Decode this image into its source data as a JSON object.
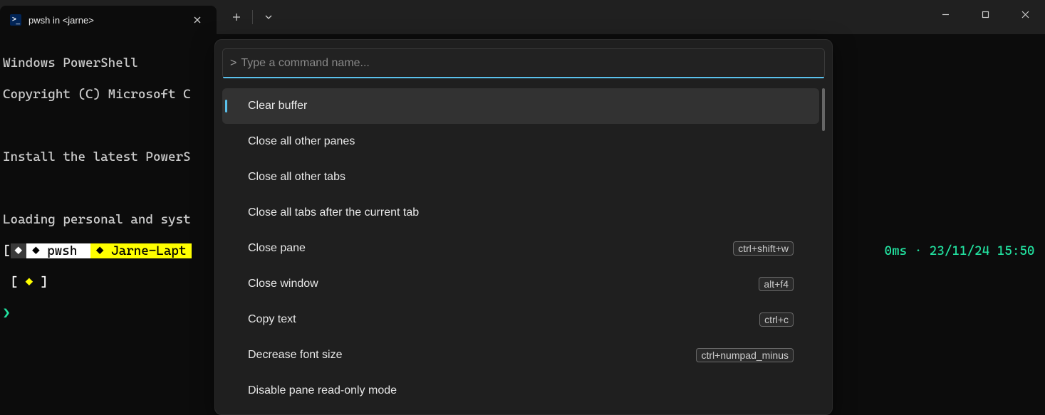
{
  "titlebar": {
    "tab_title": "pwsh in <jarne>"
  },
  "terminal": {
    "line1": "Windows PowerShell",
    "line2": "Copyright (C) Microsoft C",
    "line4": "Install the latest PowerS",
    "line6": "Loading personal and syst",
    "prompt": {
      "lead": "◆",
      "pwsh_icon": "◆",
      "pwsh": "pwsh",
      "host_icon": "◆",
      "host": "Jarne-Lapt",
      "right_time": "0ms",
      "right_sep": "·",
      "right_date": "23/11/24 15:50"
    },
    "bracket_open": "[",
    "bracket_in": " ◆ ",
    "bracket_close": "]",
    "prompt2": "❯"
  },
  "palette": {
    "prefix": ">",
    "placeholder": "Type a command name...",
    "items": [
      {
        "label": "Clear buffer",
        "kbd": "",
        "selected": true
      },
      {
        "label": "Close all other panes",
        "kbd": ""
      },
      {
        "label": "Close all other tabs",
        "kbd": ""
      },
      {
        "label": "Close all tabs after the current tab",
        "kbd": ""
      },
      {
        "label": "Close pane",
        "kbd": "ctrl+shift+w"
      },
      {
        "label": "Close window",
        "kbd": "alt+f4"
      },
      {
        "label": "Copy text",
        "kbd": "ctrl+c"
      },
      {
        "label": "Decrease font size",
        "kbd": "ctrl+numpad_minus"
      },
      {
        "label": "Disable pane read-only mode",
        "kbd": ""
      }
    ]
  }
}
